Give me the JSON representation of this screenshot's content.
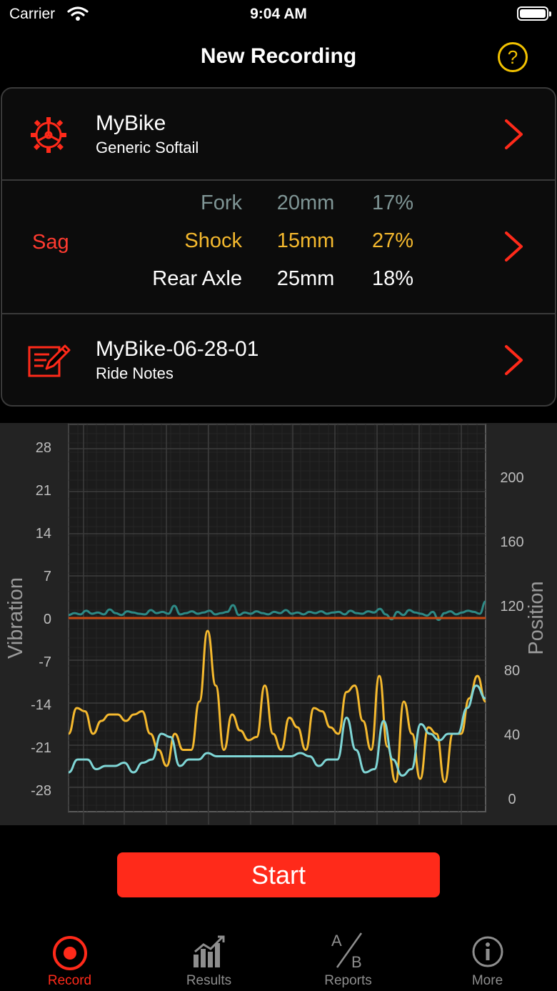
{
  "status": {
    "carrier": "Carrier",
    "time": "9:04 AM"
  },
  "nav": {
    "title": "New Recording",
    "help": "?"
  },
  "bike": {
    "name": "MyBike",
    "model": "Generic Softail"
  },
  "sag": {
    "label": "Sag",
    "rows": [
      {
        "name": "Fork",
        "mm": "20mm",
        "pct": "17%"
      },
      {
        "name": "Shock",
        "mm": "15mm",
        "pct": "27%"
      },
      {
        "name": "Rear Axle",
        "mm": "25mm",
        "pct": "18%"
      }
    ]
  },
  "notes": {
    "title": "MyBike-06-28-01",
    "subtitle": "Ride Notes"
  },
  "chart_data": {
    "type": "line",
    "ylabel_left": "Vibration",
    "ylabel_right": "Position",
    "left_ticks": [
      "28",
      "21",
      "14",
      "7",
      "0",
      "-7",
      "-14",
      "-21",
      "-28"
    ],
    "right_ticks": [
      "200",
      "160",
      "120",
      "80",
      "40",
      "0"
    ],
    "ylim_left": [
      -28,
      28
    ],
    "ylim_right": [
      0,
      200
    ],
    "grid": true,
    "series": [
      {
        "axis": "left",
        "color": "#2e8a86",
        "values": [
          0.5,
          0.8,
          0.6,
          1.2,
          0.7,
          0.9,
          0.6,
          1.4,
          0.8,
          0.5,
          1.1,
          0.9,
          0.7,
          0.6,
          1.3,
          0.8,
          1.0,
          0.7,
          2.0,
          0.6,
          0.8,
          1.1,
          0.7,
          0.9,
          1.2,
          0.6,
          0.8,
          1.0,
          2.1,
          0.5,
          0.9,
          0.7,
          1.1,
          0.8,
          0.6,
          1.0,
          0.8,
          1.3,
          0.7,
          0.9,
          0.6,
          1.0,
          0.8,
          1.1,
          0.7,
          0.9,
          1.0,
          0.6,
          1.2,
          0.8,
          0.7,
          1.1,
          0.9,
          1.5,
          0.6,
          -0.2,
          1.0,
          0.5,
          1.3,
          0.9,
          0.7,
          0.4,
          1.0,
          -0.3,
          0.8,
          1.1,
          0.6,
          0.9,
          1.2,
          1.0,
          0.7,
          2.7
        ]
      },
      {
        "axis": "left",
        "color": "#c84a12",
        "values": [
          0,
          0
        ]
      },
      {
        "axis": "right",
        "color": "#f5b92e",
        "values": [
          40,
          56,
          54,
          40,
          48,
          52,
          52,
          48,
          52,
          54,
          40,
          30,
          20,
          40,
          30,
          30,
          60,
          104,
          70,
          30,
          52,
          42,
          36,
          38,
          70,
          40,
          30,
          50,
          44,
          30,
          56,
          54,
          44,
          40,
          66,
          70,
          48,
          30,
          76,
          32,
          10,
          60,
          40,
          12,
          44,
          40,
          10,
          40,
          40,
          62,
          76,
          60
        ]
      },
      {
        "axis": "right",
        "color": "#7fd6d6",
        "values": [
          16,
          24,
          24,
          18,
          20,
          20,
          22,
          16,
          22,
          24,
          40,
          38,
          20,
          24,
          24,
          28,
          26,
          26,
          26,
          26,
          26,
          26,
          26,
          26,
          26,
          28,
          26,
          20,
          24,
          24,
          50,
          30,
          16,
          18,
          48,
          24,
          14,
          18,
          46,
          40,
          36,
          40,
          40,
          56,
          70,
          62
        ]
      }
    ]
  },
  "start": {
    "label": "Start"
  },
  "tabs": [
    {
      "label": "Record",
      "active": true
    },
    {
      "label": "Results",
      "active": false
    },
    {
      "label": "Reports",
      "active": false
    },
    {
      "label": "More",
      "active": false
    }
  ],
  "colors": {
    "accent_red": "#ff2a1a",
    "accent_yellow": "#f2c200",
    "fork": "#7f9595",
    "shock": "#f5b92e",
    "rear": "#ffffff"
  }
}
